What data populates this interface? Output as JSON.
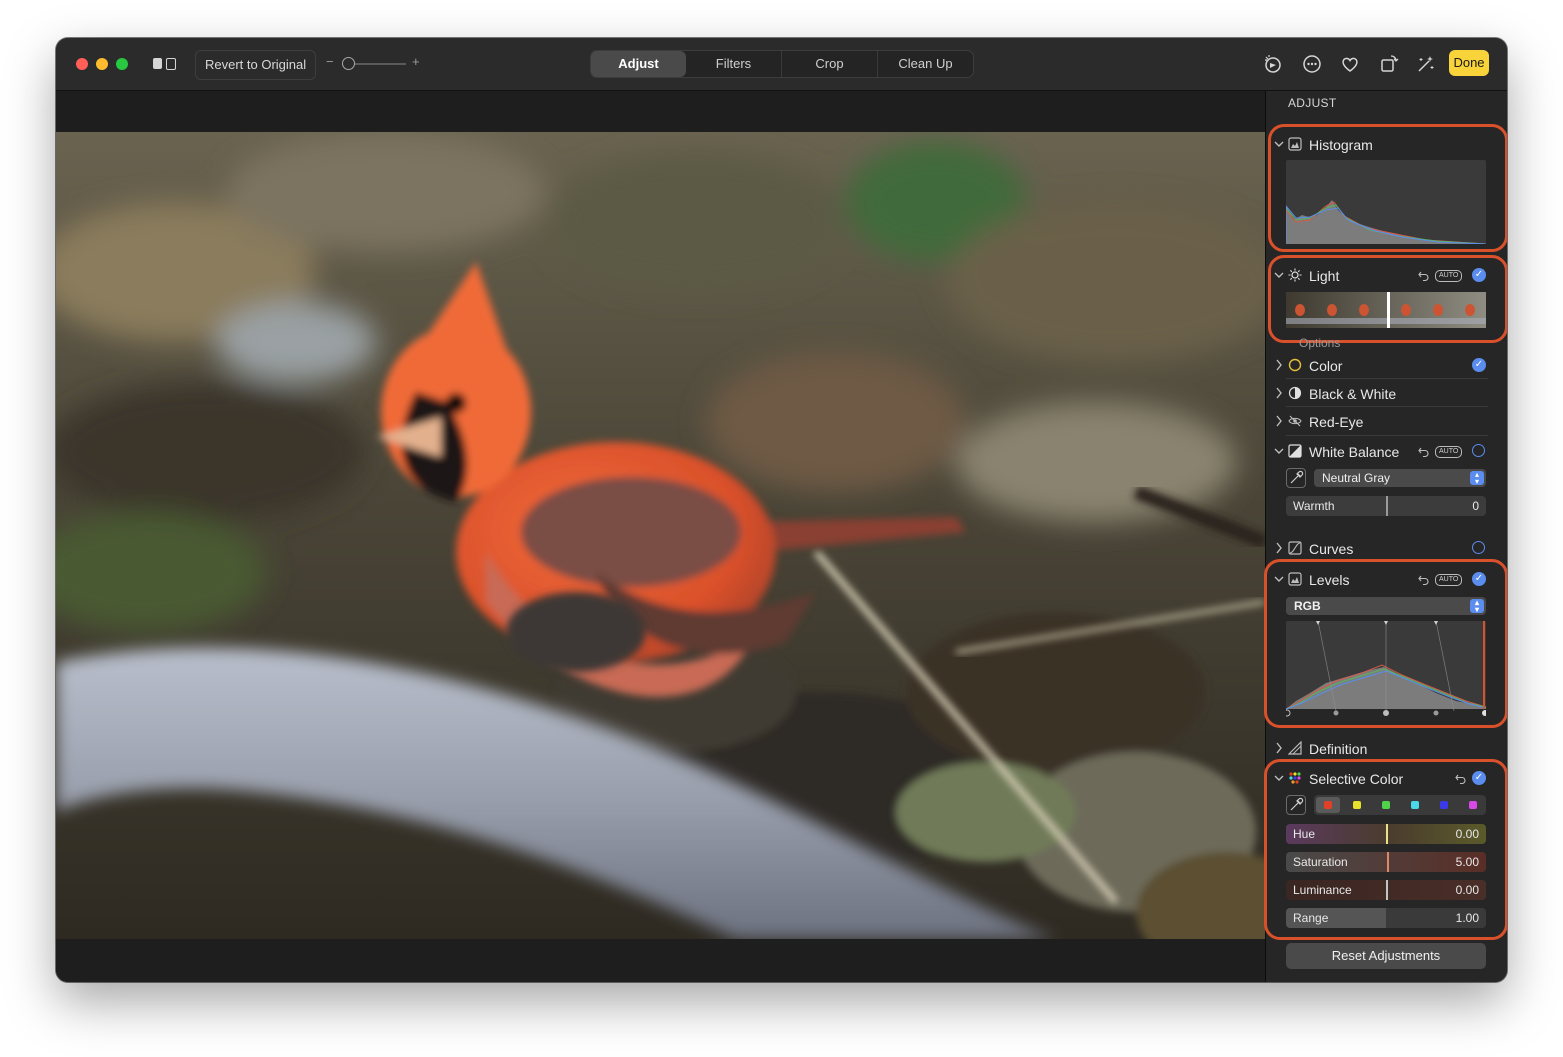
{
  "toolbar": {
    "revert_label": "Revert to Original",
    "zoom_minus": "−",
    "zoom_plus": "+",
    "zoom_level": 0.05,
    "tabs": [
      {
        "label": "Adjust",
        "active": true
      },
      {
        "label": "Filters",
        "active": false
      },
      {
        "label": "Crop",
        "active": false
      },
      {
        "label": "Clean Up",
        "active": false
      }
    ],
    "icons": [
      "auto-enhance-icon",
      "more-icon",
      "heart-icon",
      "rotate-icon",
      "magic-wand-icon"
    ],
    "done_label": "Done"
  },
  "sidebar": {
    "title": "ADJUST",
    "histogram": {
      "label": "Histogram"
    },
    "light": {
      "label": "Light",
      "auto": "AUTO",
      "enabled": true,
      "options_label": "Options"
    },
    "color": {
      "label": "Color",
      "enabled": true
    },
    "black_white": {
      "label": "Black & White"
    },
    "red_eye": {
      "label": "Red-Eye"
    },
    "white_balance": {
      "label": "White Balance",
      "auto": "AUTO",
      "enabled": false,
      "mode": "Neutral Gray",
      "warmth_label": "Warmth",
      "warmth_value": "0"
    },
    "curves": {
      "label": "Curves",
      "enabled": false
    },
    "levels": {
      "label": "Levels",
      "auto": "AUTO",
      "enabled": true,
      "channel": "RGB"
    },
    "definition": {
      "label": "Definition"
    },
    "selective_color": {
      "label": "Selective Color",
      "enabled": true,
      "swatches": [
        "#e0402a",
        "#e8e32a",
        "#4ed34a",
        "#4ad9e8",
        "#3a3ae8",
        "#d84ae8"
      ],
      "hue_label": "Hue",
      "hue_value": "0.00",
      "saturation_label": "Saturation",
      "saturation_value": "5.00",
      "luminance_label": "Luminance",
      "luminance_value": "0.00",
      "range_label": "Range",
      "range_value": "1.00"
    },
    "reset_label": "Reset Adjustments"
  },
  "colors": {
    "accent": "#5a8dee",
    "done": "#f9d33a",
    "highlight": "#d9512a"
  }
}
